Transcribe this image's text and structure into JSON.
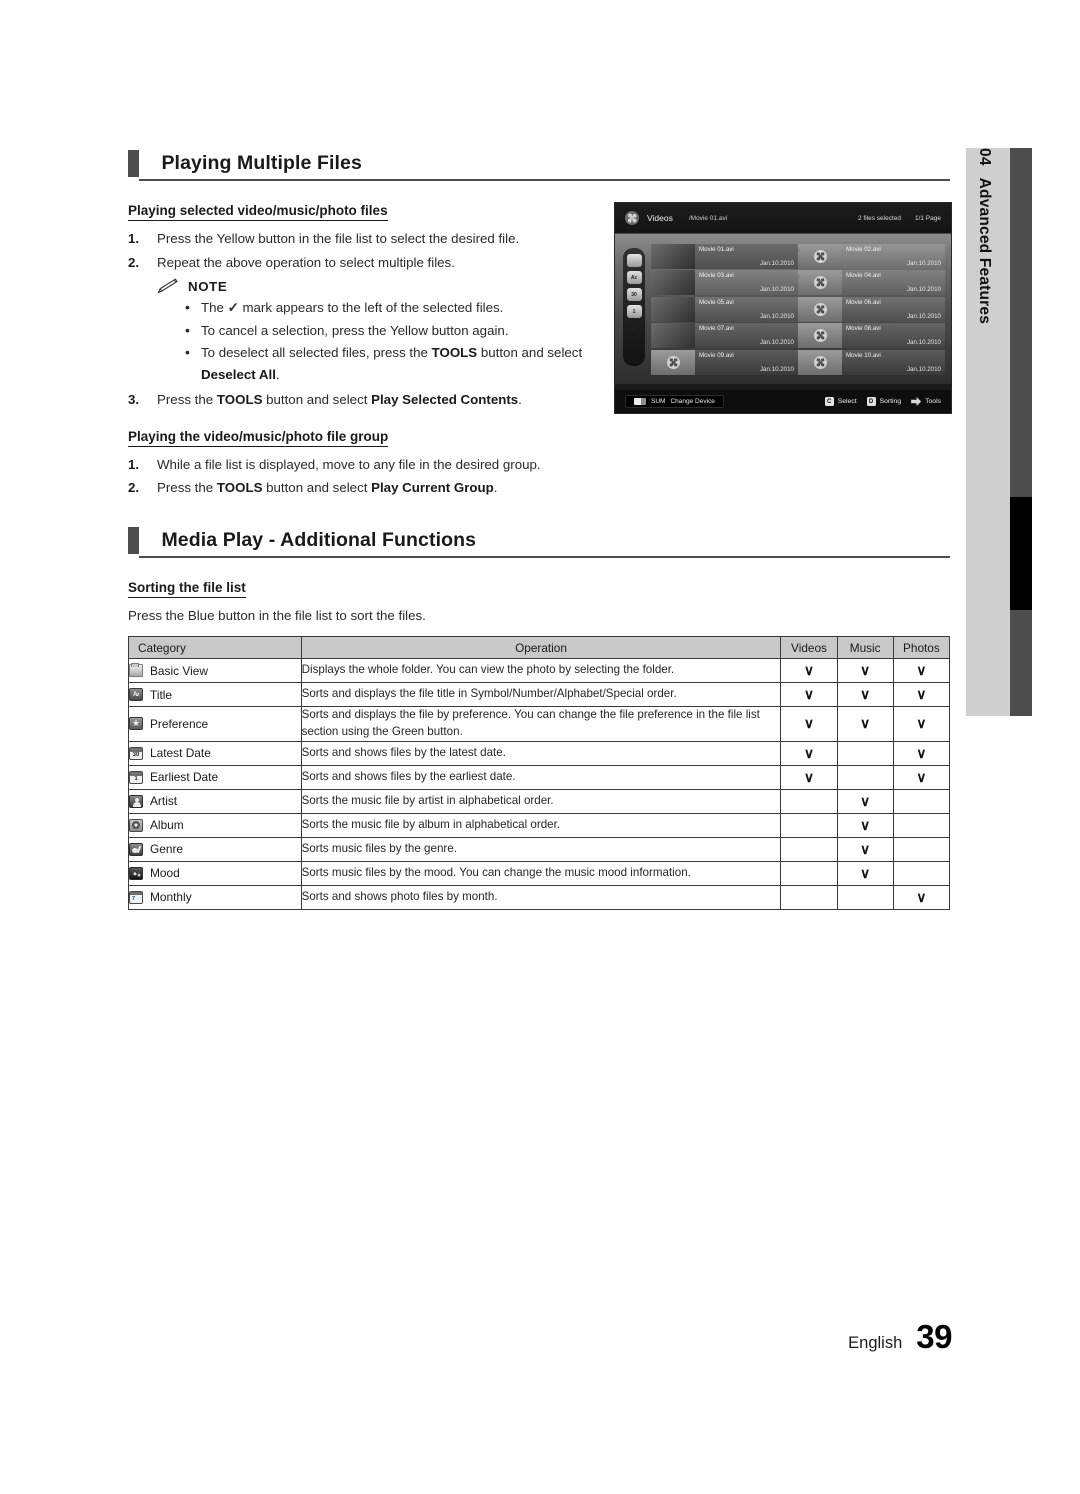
{
  "chapter_tab": {
    "number": "04",
    "label": "Advanced Features"
  },
  "sections": [
    {
      "heading": "Playing Multiple Files",
      "sub1": "Playing selected video/music/photo files",
      "steps1": [
        {
          "num": "1.",
          "text": "Press the Yellow button in the file list to select the desired file."
        },
        {
          "num": "2.",
          "text": "Repeat the above operation to select multiple files."
        }
      ],
      "note_label": "NOTE",
      "note_items": [
        "The ✓ mark appears to the left of the selected files.",
        "To cancel a selection, press the Yellow button again.",
        "To deselect all selected files, press the TOOLS button and select Deselect All."
      ],
      "step3": {
        "num": "3.",
        "text": "Press the TOOLS button and select Play Selected Contents."
      },
      "sub2": "Playing the video/music/photo file group",
      "steps2": [
        {
          "num": "1.",
          "text": "While a file list is displayed, move to any file in the desired group."
        },
        {
          "num": "2.",
          "text": "Press the TOOLS button and select Play Current Group."
        }
      ]
    },
    {
      "heading": "Media Play - Additional Functions",
      "sub1": "Sorting the file list",
      "intro": "Press the Blue button in the file list to sort the files."
    }
  ],
  "tv_screenshot": {
    "category": "Videos",
    "path": "/Movie 01.avi",
    "selected_count": "2 files selected",
    "page": "1/1 Page",
    "sidebar_icons": [
      "folder-icon",
      "title-az-icon",
      "latest-date-icon",
      "earliest-date-icon",
      "star-icon"
    ],
    "files": [
      {
        "name": "Movie 01.avi",
        "date": "Jan.10.2010",
        "selected": false,
        "highlighted": true,
        "thumb": "photo"
      },
      {
        "name": "Movie 02.avi",
        "date": "Jan.10.2010",
        "selected": true,
        "highlighted": false,
        "thumb": "reel"
      },
      {
        "name": "Movie 03.avi",
        "date": "Jan.10.2010",
        "selected": false,
        "highlighted": false,
        "thumb": "photo"
      },
      {
        "name": "Movie 04.avi",
        "date": "Jan.10.2010",
        "selected": true,
        "highlighted": false,
        "thumb": "reel"
      },
      {
        "name": "Movie 05.avi",
        "date": "Jan.10.2010",
        "selected": false,
        "highlighted": false,
        "thumb": "photo"
      },
      {
        "name": "Movie 06.avi",
        "date": "Jan.10.2010",
        "selected": false,
        "highlighted": false,
        "thumb": "reel"
      },
      {
        "name": "Movie 07.avi",
        "date": "Jan.10.2010",
        "selected": false,
        "highlighted": false,
        "thumb": "photo"
      },
      {
        "name": "Movie 08.avi",
        "date": "Jan.10.2010",
        "selected": false,
        "highlighted": false,
        "thumb": "reel"
      },
      {
        "name": "Movie 09.avi",
        "date": "Jan.10.2010",
        "selected": false,
        "highlighted": false,
        "thumb": "reel"
      },
      {
        "name": "Movie 10.avi",
        "date": "Jan.10.2010",
        "selected": false,
        "highlighted": false,
        "thumb": "reel"
      }
    ],
    "bottom_left": {
      "device": "SUM",
      "label": "Change Device"
    },
    "bottom_right": [
      {
        "key": "C",
        "label": "Select"
      },
      {
        "key": "D",
        "label": "Sorting"
      },
      {
        "key": "",
        "label": "Tools"
      }
    ]
  },
  "table": {
    "headers": [
      "Category",
      "Operation",
      "Videos",
      "Music",
      "Photos"
    ],
    "rows": [
      {
        "icon": "folder-icon",
        "category": "Basic View",
        "operation": "Displays the whole folder. You can view the photo by selecting the folder.",
        "videos": "∨",
        "music": "∨",
        "photos": "∨"
      },
      {
        "icon": "title-az-icon",
        "category": "Title",
        "operation": "Sorts and displays the file title in Symbol/Number/Alphabet/Special order.",
        "videos": "∨",
        "music": "∨",
        "photos": "∨"
      },
      {
        "icon": "star-icon",
        "category": "Preference",
        "operation": "Sorts and displays the file by preference. You can change the file preference in the file list section using the Green button.",
        "videos": "∨",
        "music": "∨",
        "photos": "∨"
      },
      {
        "icon": "latest-date-icon",
        "category": "Latest Date",
        "operation": "Sorts and shows files by the latest date.",
        "videos": "∨",
        "music": "",
        "photos": "∨"
      },
      {
        "icon": "earliest-date-icon",
        "category": "Earliest Date",
        "operation": "Sorts and shows files by the earliest date.",
        "videos": "∨",
        "music": "",
        "photos": "∨"
      },
      {
        "icon": "artist-icon",
        "category": "Artist",
        "operation": "Sorts the music file by artist in alphabetical order.",
        "videos": "",
        "music": "∨",
        "photos": ""
      },
      {
        "icon": "album-icon",
        "category": "Album",
        "operation": "Sorts the music file by album in alphabetical order.",
        "videos": "",
        "music": "∨",
        "photos": ""
      },
      {
        "icon": "genre-icon",
        "category": "Genre",
        "operation": "Sorts music files by the genre.",
        "videos": "",
        "music": "∨",
        "photos": ""
      },
      {
        "icon": "mood-icon",
        "category": "Mood",
        "operation": "Sorts music files by the mood. You can change the music mood information.",
        "videos": "",
        "music": "∨",
        "photos": ""
      },
      {
        "icon": "monthly-icon",
        "category": "Monthly",
        "operation": "Sorts and shows photo files by month.",
        "videos": "",
        "music": "",
        "photos": "∨"
      }
    ]
  },
  "footer": {
    "language": "English",
    "page_number": "39"
  }
}
